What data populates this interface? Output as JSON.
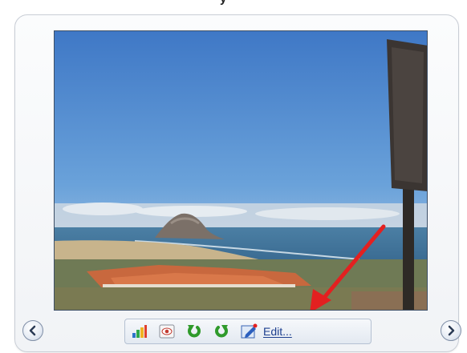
{
  "window": {
    "title_fragment": "y"
  },
  "photo": {
    "description_icon": "landscape-photo"
  },
  "navigation": {
    "prev_icon": "chevron-left-icon",
    "next_icon": "chevron-right-icon"
  },
  "toolbar": {
    "buttons": [
      {
        "name": "histogram",
        "icon": "bar-chart-icon"
      },
      {
        "name": "red-eye",
        "icon": "eye-icon"
      },
      {
        "name": "rotate-left",
        "icon": "rotate-counterclockwise-icon"
      },
      {
        "name": "rotate-right",
        "icon": "rotate-clockwise-icon"
      }
    ],
    "edit_label": "Edit..."
  },
  "colors": {
    "accent_arrow": "#e32020",
    "rotate_green": "#2f9a2b",
    "link_blue": "#1d3f8f"
  }
}
